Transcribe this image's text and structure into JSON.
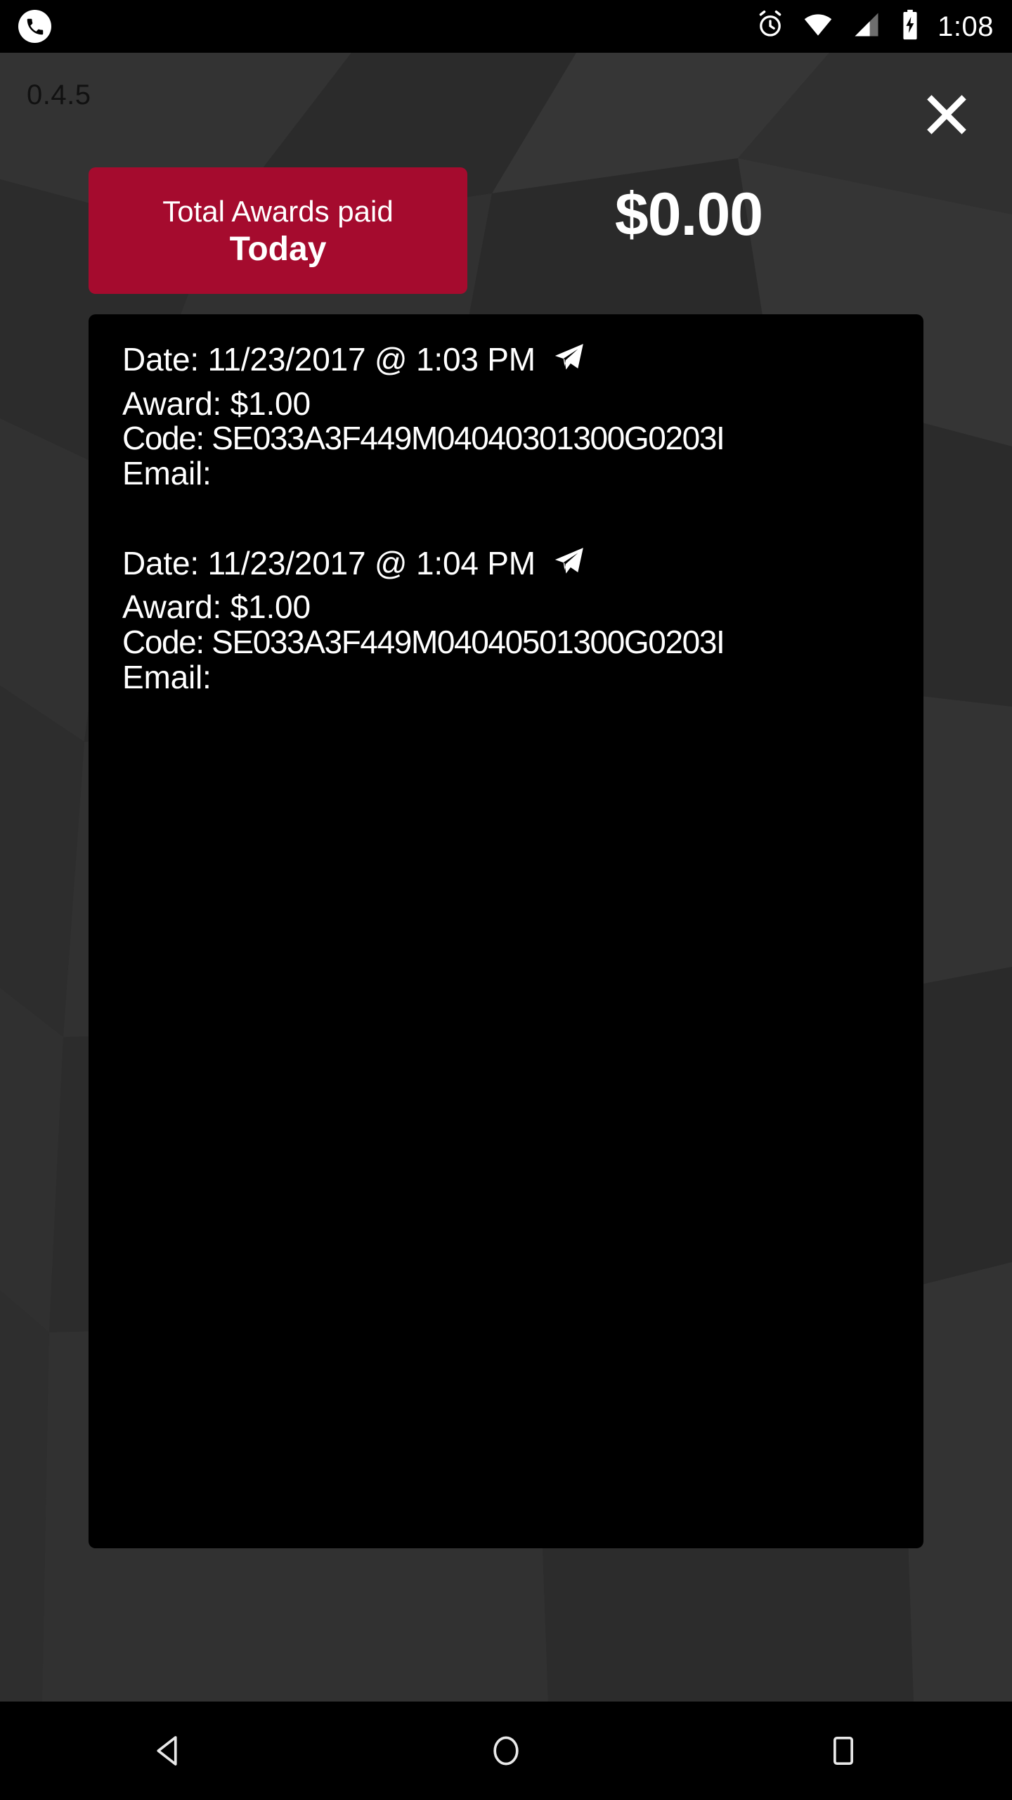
{
  "status_bar": {
    "left_icon": "phone-call-icon",
    "icons": [
      "alarm-clock-icon",
      "wifi-icon",
      "cell-signal-icon",
      "battery-charging-icon"
    ],
    "time": "1:08"
  },
  "header": {
    "version": "0.4.5",
    "close_icon": "close-icon"
  },
  "summary": {
    "banner_line1": "Total Awards paid",
    "banner_line2": "Today",
    "banner_color": "#a50b2e",
    "amount": "$0.00"
  },
  "records": [
    {
      "date_label": "Date: 11/23/2017 @ 1:03 PM",
      "send_icon": "send-icon",
      "award_label": "Award: $1.00",
      "code_label": "Code: SE033A3F449M04040301300G0203I",
      "email_label": "Email:"
    },
    {
      "date_label": "Date: 11/23/2017 @ 1:04 PM",
      "send_icon": "send-icon",
      "award_label": "Award: $1.00",
      "code_label": "Code: SE033A3F449M04040501300G0203I",
      "email_label": "Email:"
    }
  ],
  "nav_bar": {
    "back": "back-triangle-icon",
    "home": "home-circle-icon",
    "recents": "recents-square-icon"
  }
}
